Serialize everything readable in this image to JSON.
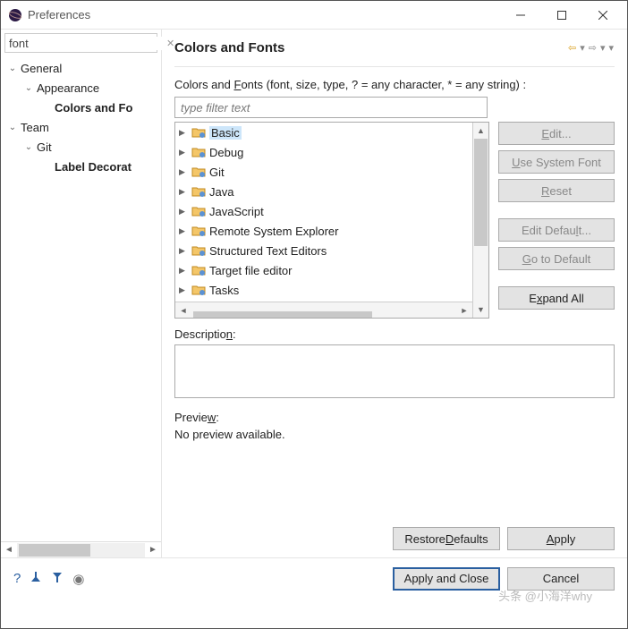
{
  "window": {
    "title": "Preferences"
  },
  "sidebar": {
    "search_value": "font",
    "items": [
      {
        "label": "General",
        "level": 1,
        "expanded": true,
        "bold": false
      },
      {
        "label": "Appearance",
        "level": 2,
        "expanded": true,
        "bold": false
      },
      {
        "label": "Colors and Fo",
        "level": 3,
        "expanded": false,
        "bold": true,
        "selected": true
      },
      {
        "label": "Team",
        "level": 1,
        "expanded": true,
        "bold": false
      },
      {
        "label": "Git",
        "level": 2,
        "expanded": true,
        "bold": false
      },
      {
        "label": "Label Decorat",
        "level": 3,
        "expanded": false,
        "bold": true
      }
    ]
  },
  "page": {
    "title": "Colors and Fonts",
    "instruction_prefix": "Colors and ",
    "instruction_u": "F",
    "instruction_suffix": "onts (font, size, type, ? = any character, * = any string) :",
    "filter_placeholder": "type filter text",
    "tree_items": [
      {
        "label": "Basic",
        "selected": true
      },
      {
        "label": "Debug"
      },
      {
        "label": "Git"
      },
      {
        "label": "Java"
      },
      {
        "label": "JavaScript"
      },
      {
        "label": "Remote System Explorer"
      },
      {
        "label": "Structured Text Editors"
      },
      {
        "label": "Target file editor"
      },
      {
        "label": "Tasks"
      }
    ],
    "buttons": {
      "edit_u": "E",
      "edit_rest": "dit...",
      "use_sys_u": "U",
      "use_sys_rest": "se System Font",
      "reset_u": "R",
      "reset_rest": "eset",
      "edit_def_label": "Edit Defau",
      "edit_def_u": "l",
      "edit_def_rest": "t...",
      "go_def_u": "G",
      "go_def_rest": "o to Default",
      "expand_u": "x",
      "expand_pre": "E",
      "expand_rest": "pand All"
    },
    "description_label_pre": "Descriptio",
    "description_label_u": "n",
    "description_label_post": ":",
    "preview_label_pre": "Previe",
    "preview_label_u": "w",
    "preview_label_post": ":",
    "preview_text": "No preview available.",
    "restore_pre": "Restore ",
    "restore_u": "D",
    "restore_rest": "efaults",
    "apply_u": "A",
    "apply_rest": "pply"
  },
  "bottom": {
    "apply_close": "Apply and Close",
    "cancel": "Cancel"
  },
  "watermark": "头条 @小海洋why"
}
